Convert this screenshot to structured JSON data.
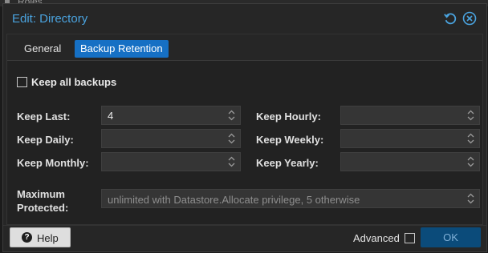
{
  "background": {
    "roles_label": "Roles"
  },
  "dialog": {
    "title": "Edit: Directory",
    "accent_color": "#4aa3df",
    "tabs": [
      {
        "label": "General",
        "active": false
      },
      {
        "label": "Backup Retention",
        "active": true
      }
    ],
    "keep_all": {
      "label": "Keep all backups",
      "checked": false
    },
    "fields": {
      "keep_last": {
        "label": "Keep Last:",
        "value": "4"
      },
      "keep_hourly": {
        "label": "Keep Hourly:",
        "value": ""
      },
      "keep_daily": {
        "label": "Keep Daily:",
        "value": ""
      },
      "keep_weekly": {
        "label": "Keep Weekly:",
        "value": ""
      },
      "keep_monthly": {
        "label": "Keep Monthly:",
        "value": ""
      },
      "keep_yearly": {
        "label": "Keep Yearly:",
        "value": ""
      },
      "max_protected": {
        "label_line1": "Maximum",
        "label_line2": "Protected:",
        "placeholder": "unlimited with Datastore.Allocate privilege, 5 otherwise"
      }
    },
    "footer": {
      "help_label": "Help",
      "advanced_label": "Advanced",
      "advanced_checked": false,
      "ok_label": "OK"
    },
    "icons": [
      "reset-icon",
      "close-icon",
      "help-icon",
      "spinner-icon"
    ]
  }
}
